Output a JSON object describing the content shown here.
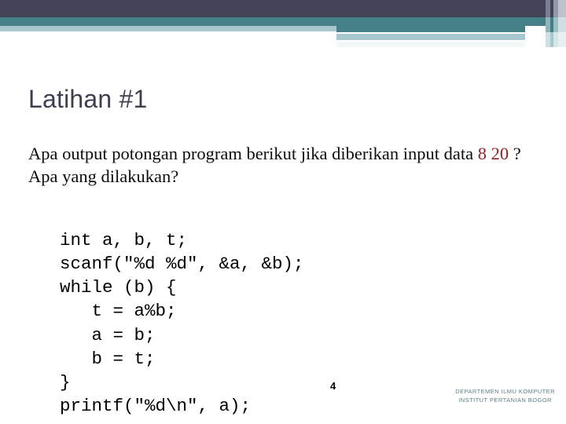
{
  "slide": {
    "title": "Latihan #1",
    "page_number": "4"
  },
  "question": {
    "line1_before": "Apa output potongan program berikut jika diberikan input data ",
    "highlight": "8 20",
    "line1_after": " ? Apa yang dilakukan?"
  },
  "code_block": {
    "language": "c",
    "text": "int a, b, t;\nscanf(\"%d %d\", &a, &b);\nwhile (b) {\n   t = a%b;\n   a = b;\n   b = t;\n}\nprintf(\"%d\\n\", a);"
  },
  "footer": {
    "line1": "DEPARTEMEN ILMU KOMPUTER",
    "line2": "INSTITUT PERTANIAN BOGOR"
  },
  "theme": {
    "header_dark": "#434457",
    "header_teal": "#458088",
    "header_light_blue": "#a7c6ce",
    "title_color": "#3d3f50",
    "highlight_color": "#8e2222",
    "footer_color": "#5d7f87",
    "background": "#ffffff"
  }
}
